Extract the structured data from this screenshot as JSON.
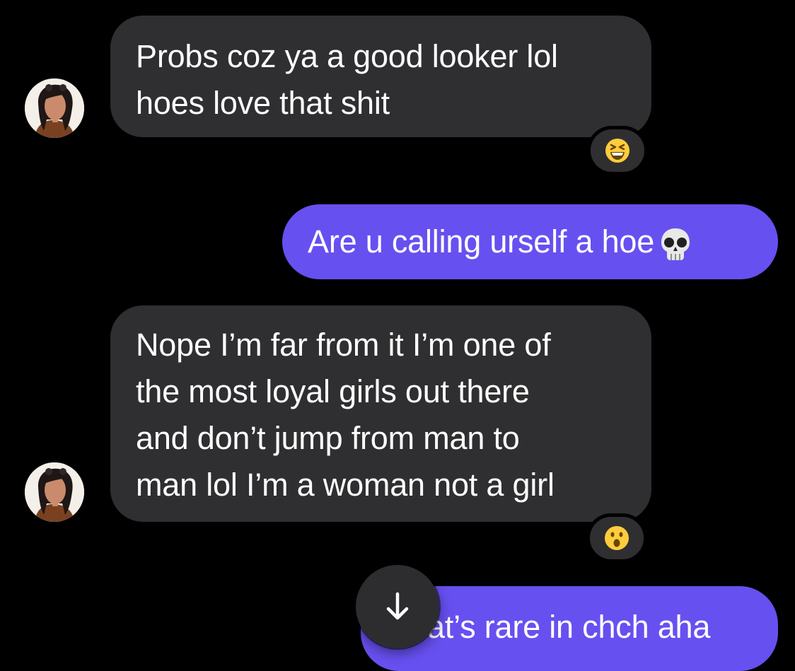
{
  "messages": [
    {
      "direction": "incoming",
      "lines": [
        "Probs coz ya a good looker lol",
        "hoes love that shit"
      ],
      "reaction": "grinning-squinting-face"
    },
    {
      "direction": "outgoing",
      "text": "Are u calling urself a hoe",
      "emoji": "skull"
    },
    {
      "direction": "incoming",
      "lines": [
        "Nope I’m far from it I’m one of",
        "the most loyal girls out there",
        "and don’t jump from man to",
        "man lol I’m a woman not a girl"
      ],
      "reaction": "hushed-face"
    },
    {
      "direction": "outgoing",
      "text": "at’s rare in chch aha"
    }
  ],
  "colors": {
    "background": "#000000",
    "incoming_bubble": "#2f2f31",
    "outgoing_bubble": "#6750f0",
    "text": "#ffffff",
    "scroll_button": "#2d2d2f"
  },
  "scroll_button_icon": "arrow-down-icon",
  "avatar_icon": "contact-avatar"
}
